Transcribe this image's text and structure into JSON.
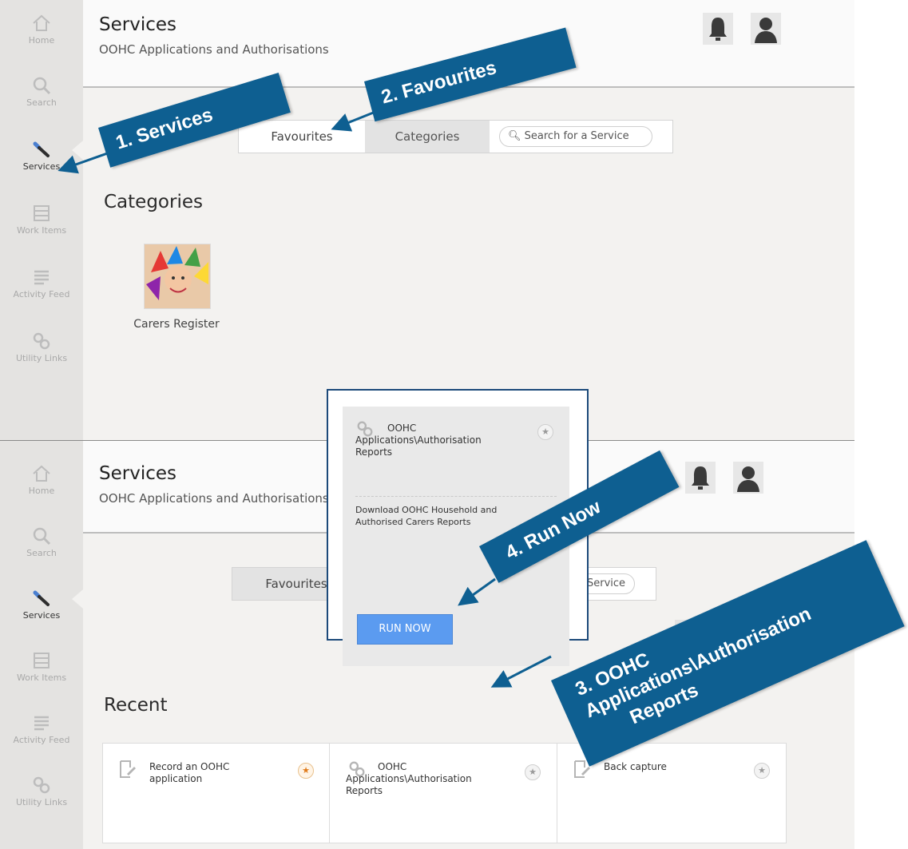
{
  "sidebar": {
    "items": [
      {
        "label": "Home",
        "icon": "home-icon"
      },
      {
        "label": "Search",
        "icon": "search-icon"
      },
      {
        "label": "Services",
        "icon": "wrench-icon"
      },
      {
        "label": "Work Items",
        "icon": "work-items-icon"
      },
      {
        "label": "Activity Feed",
        "icon": "activity-feed-icon"
      },
      {
        "label": "Utility Links",
        "icon": "link-icon"
      }
    ]
  },
  "header": {
    "title": "Services",
    "subtitle": "OOHC Applications and Authorisations"
  },
  "tabs": {
    "favourites": "Favourites",
    "categories": "Categories",
    "search_placeholder": "Search for a Service",
    "search_partial": "Service"
  },
  "categories": {
    "heading": "Categories",
    "items": [
      {
        "label": "Carers Register"
      }
    ]
  },
  "recent": {
    "heading": "Recent",
    "items": [
      {
        "label": "Record an OOHC application",
        "favourite": true
      },
      {
        "label": "OOHC Applications\\Authorisation Reports",
        "favourite": false
      },
      {
        "label": "Back capture",
        "favourite": false
      }
    ]
  },
  "popup": {
    "title": "OOHC Applications\\Authorisation Reports",
    "description": "Download OOHC Household and Authorised Carers Reports",
    "button": "RUN NOW"
  },
  "callouts": {
    "step1": "1. Services",
    "step2": "2. Favourites",
    "step3_line1": "3. OOHC",
    "step3_line2": "Applications\\Authorisation",
    "step3_line3": "Reports",
    "step4": "4. Run Now"
  },
  "colors": {
    "callout": "#0e5f91",
    "run_button": "#5b9bf0",
    "accent_star": "#e07b1a"
  }
}
